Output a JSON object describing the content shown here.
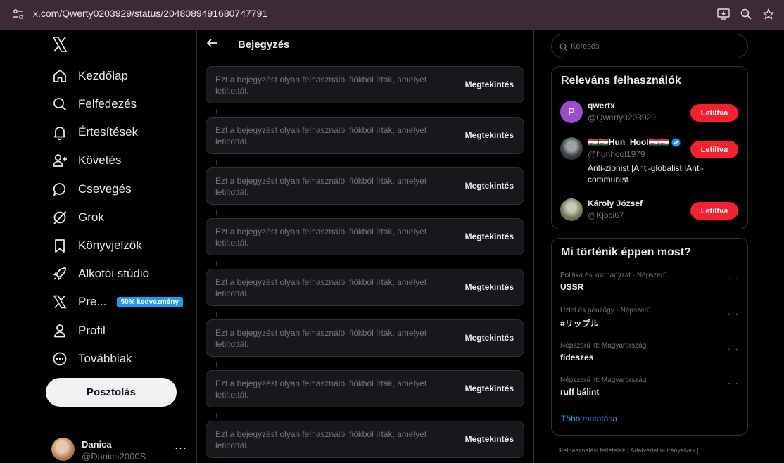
{
  "browser": {
    "url": "x.com/Qwerty0203929/status/2048089491680747791"
  },
  "nav": {
    "items": [
      {
        "label": "Kezdőlap",
        "icon": "home-icon"
      },
      {
        "label": "Felfedezés",
        "icon": "search-icon"
      },
      {
        "label": "Értesítések",
        "icon": "bell-icon"
      },
      {
        "label": "Követés",
        "icon": "follow-icon"
      },
      {
        "label": "Csevegés",
        "icon": "chat-icon"
      },
      {
        "label": "Grok",
        "icon": "grok-icon"
      },
      {
        "label": "Könyvjelzők",
        "icon": "bookmark-icon"
      },
      {
        "label": "Alkotói stúdió",
        "icon": "rocket-icon"
      },
      {
        "label": "Pre...",
        "icon": "x-icon",
        "badge": "50% kedvezmény"
      },
      {
        "label": "Profil",
        "icon": "person-icon"
      },
      {
        "label": "Továbbiak",
        "icon": "more-circle-icon"
      }
    ],
    "post_button": "Posztolás",
    "account": {
      "name": "Danica",
      "handle": "@Danica2000S",
      "more": "···"
    }
  },
  "main": {
    "title": "Bejegyzés",
    "blocked_posts": [
      {
        "text": "Ezt a bejegyzést olyan felhasználói fiókból írták, amelyet letiltottál.",
        "action": "Megtekintés"
      },
      {
        "text": "Ezt a bejegyzést olyan felhasználói fiókból írták, amelyet letiltottál.",
        "action": "Megtekintés"
      },
      {
        "text": "Ezt a bejegyzést olyan felhasználói fiókból írták, amelyet letiltottál.",
        "action": "Megtekintés"
      },
      {
        "text": "Ezt a bejegyzést olyan felhasználói fiókból írták, amelyet letiltottál.",
        "action": "Megtekintés"
      },
      {
        "text": "Ezt a bejegyzést olyan felhasználói fiókból írták, amelyet letiltottál.",
        "action": "Megtekintés"
      },
      {
        "text": "Ezt a bejegyzést olyan felhasználói fiókból írták, amelyet letiltottál.",
        "action": "Megtekintés"
      },
      {
        "text": "Ezt a bejegyzést olyan felhasználói fiókból írták, amelyet letiltottál.",
        "action": "Megtekintés"
      },
      {
        "text": "Ezt a bejegyzést olyan felhasználói fiókból írták, amelyet letiltottál.",
        "action": "Megtekintés"
      }
    ]
  },
  "right": {
    "search_placeholder": "Keresés",
    "relevant": {
      "title": "Releváns felhasználók",
      "users": [
        {
          "name": "qwertx",
          "handle": "@Qwerty0203929",
          "bio": "",
          "button": "Letiltva",
          "avatar_letter": "P",
          "avatar_color": "#9b4dca"
        },
        {
          "name": "🇭🇺🇭🇺Hun_Hool🇭🇺🇭🇺",
          "handle": "@hunhool1979",
          "bio": "Anti-zionist |Anti-globalist |Anti-communist",
          "button": "Letiltva",
          "verified": true
        },
        {
          "name": "Károly József",
          "handle": "@Kjoci67",
          "bio": "",
          "button": "Letiltva"
        }
      ]
    },
    "trends": {
      "title": "Mi történik éppen most?",
      "items": [
        {
          "category": "Politika és kormányzat · Népszerű",
          "name": "USSR"
        },
        {
          "category": "Üzlet és pénzügy · Népszerű",
          "name": "#リップル"
        },
        {
          "category": "Népszerű itt: Magyarország",
          "name": "fideszes"
        },
        {
          "category": "Népszerű itt: Magyarország",
          "name": "ruff bálint"
        }
      ],
      "show_more": "Több mutatása"
    },
    "footer": {
      "line1": "Felhasználási feltételek  |   Adatvédelmi irányelvek  |"
    }
  },
  "colors": {
    "accent": "#1d9bf0",
    "block_red": "#f4212e",
    "browser_bar": "#3c2a36"
  }
}
